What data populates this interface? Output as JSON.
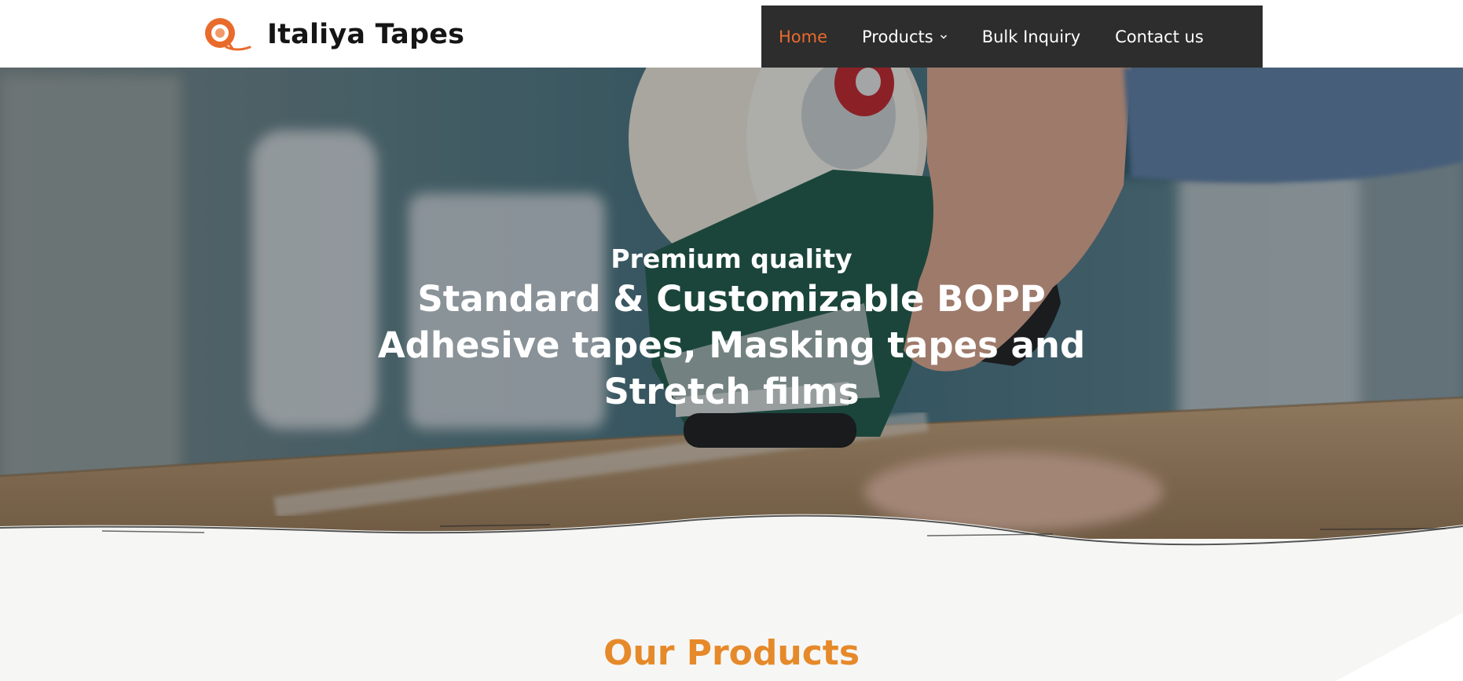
{
  "brand": {
    "name": "Italiya Tapes",
    "logo_icon": "tape-roll-icon",
    "accent": "#e96b2b"
  },
  "nav": {
    "items": [
      {
        "label": "Home",
        "active": true
      },
      {
        "label": "Products",
        "has_dropdown": true
      },
      {
        "label": "Bulk Inquiry"
      },
      {
        "label": "Contact us"
      }
    ]
  },
  "hero": {
    "eyebrow": "Premium quality",
    "title": "Standard & Customizable BOPP Adhesive tapes, Masking tapes and Stretch films"
  },
  "section": {
    "title": "Our Products",
    "title_color": "#e6892a"
  }
}
